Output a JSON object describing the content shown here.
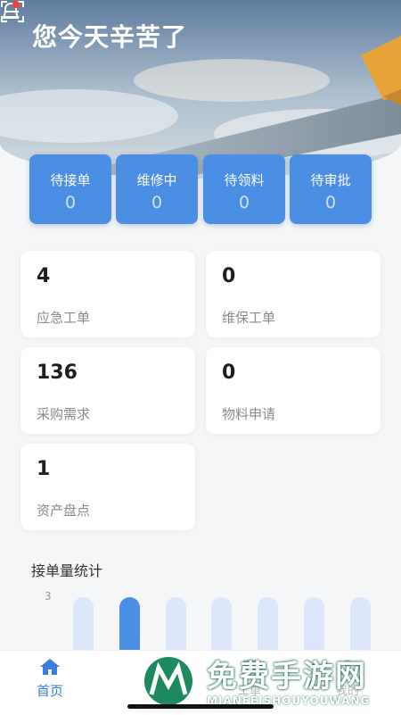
{
  "header": {
    "title": "您今天辛苦了"
  },
  "status_tiles": [
    {
      "label": "待接单",
      "count": "0"
    },
    {
      "label": "维修中",
      "count": "0"
    },
    {
      "label": "待领料",
      "count": "0"
    },
    {
      "label": "待审批",
      "count": "0"
    }
  ],
  "stats": [
    {
      "value": "4",
      "label": "应急工单"
    },
    {
      "value": "0",
      "label": "维保工单"
    },
    {
      "value": "136",
      "label": "采购需求"
    },
    {
      "value": "0",
      "label": "物料申请"
    },
    {
      "value": "1",
      "label": "资产盘点"
    }
  ],
  "chart": {
    "title": "接单量统计",
    "y_tick": "3",
    "bar_count": 7,
    "highlighted_index": 1
  },
  "bottom_nav": {
    "home_label": "首页",
    "item2_label": "工单",
    "item3_label": "我的"
  },
  "watermark": {
    "text": "免费手游网",
    "subtext": "MIANFEISHOUYOUWANG"
  },
  "colors": {
    "primary": "#4a8fe3",
    "bar_inactive": "#dbe6fa",
    "background": "#f5f6f8"
  }
}
